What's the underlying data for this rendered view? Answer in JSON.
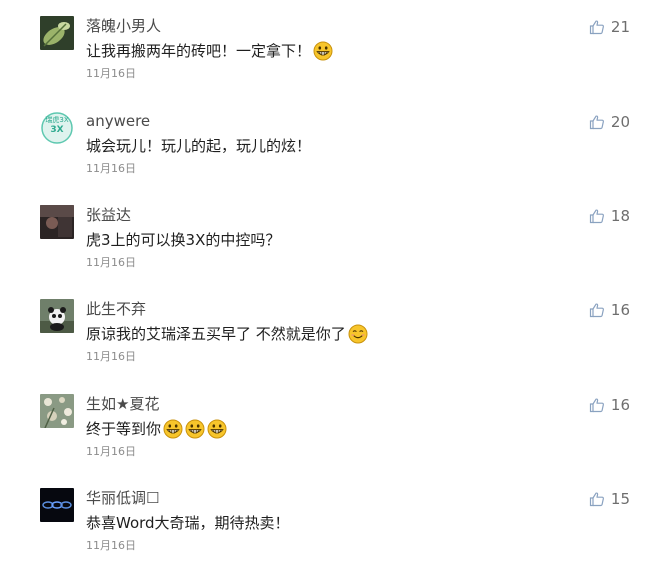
{
  "colors": {
    "text": "#1f1f1f",
    "author": "#4a4a4a",
    "date": "#8c8c8c",
    "like_icon": "#8aa2c0",
    "emoji_face": "#f5c518"
  },
  "comments": [
    {
      "author": "落魄小男人",
      "text": "让我再搬两年的砖吧！一定拿下！",
      "emojis": [
        "grin-emoji"
      ],
      "date": "11月16日",
      "likes": "21",
      "avatar": "leaf-avatar"
    },
    {
      "author": "anywere",
      "text": "城会玩儿！玩儿的起，玩儿的炫！",
      "emojis": [],
      "date": "11月16日",
      "likes": "20",
      "avatar": "badge-3x-avatar",
      "avatar_text": "瑞虎3X"
    },
    {
      "author": "张益达",
      "text": "虎3上的可以换3X的中控吗？",
      "emojis": [],
      "date": "11月16日",
      "likes": "18",
      "avatar": "dark-scene-avatar"
    },
    {
      "author": "此生不弃",
      "text": "原谅我的艾瑞泽五买早了 不然就是你了",
      "emojis": [
        "smile-emoji"
      ],
      "date": "11月16日",
      "likes": "16",
      "avatar": "panda-avatar"
    },
    {
      "author": "生如★夏花",
      "text": "终于等到你",
      "emojis": [
        "grin-emoji",
        "grin-emoji",
        "grin-emoji"
      ],
      "date": "11月16日",
      "likes": "16",
      "avatar": "flowers-avatar"
    },
    {
      "author": "华丽低调☐",
      "text": "恭喜Word大奇瑞，期待热卖！",
      "emojis": [],
      "date": "11月16日",
      "likes": "15",
      "avatar": "cars-logo-avatar"
    }
  ]
}
